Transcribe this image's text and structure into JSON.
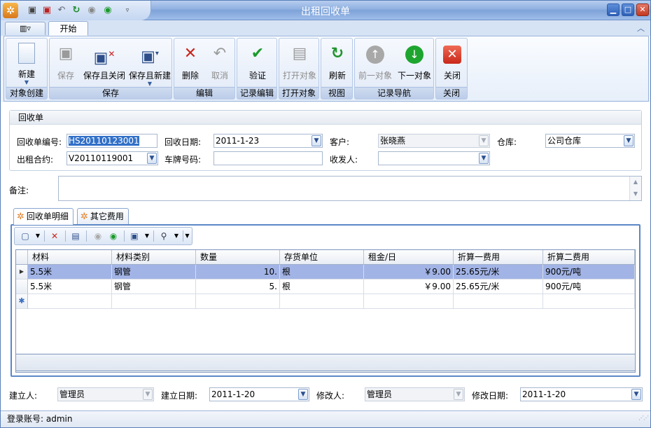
{
  "window": {
    "title": "出租回收单",
    "qat_icons": [
      "save-icon",
      "save-close-icon",
      "undo-icon",
      "refresh-icon",
      "prev-icon",
      "next-icon",
      "customize-dropdown-icon"
    ],
    "controls": [
      "minimize",
      "maximize",
      "close"
    ]
  },
  "tabs": {
    "menu_label": "",
    "home_label": "开始"
  },
  "ribbon": {
    "groups": [
      {
        "label": "对象创建",
        "buttons": [
          {
            "label": "新建",
            "icon": "new-document-icon",
            "enabled": true,
            "dropdown": true
          }
        ]
      },
      {
        "label": "保存",
        "buttons": [
          {
            "label": "保存",
            "icon": "save-icon",
            "enabled": false
          },
          {
            "label": "保存且关闭",
            "icon": "save-close-icon",
            "enabled": true
          },
          {
            "label": "保存且新建",
            "icon": "save-new-icon",
            "enabled": true,
            "dropdown": true
          }
        ]
      },
      {
        "label": "编辑",
        "buttons": [
          {
            "label": "删除",
            "icon": "delete-icon",
            "enabled": true
          },
          {
            "label": "取消",
            "icon": "undo-icon",
            "enabled": false
          }
        ]
      },
      {
        "label": "记录编辑",
        "buttons": [
          {
            "label": "验证",
            "icon": "check-icon",
            "enabled": true
          }
        ]
      },
      {
        "label": "打开对象",
        "buttons": [
          {
            "label": "打开对象",
            "icon": "open-object-icon",
            "enabled": false
          }
        ]
      },
      {
        "label": "视图",
        "buttons": [
          {
            "label": "刷新",
            "icon": "refresh-icon",
            "enabled": true
          }
        ]
      },
      {
        "label": "记录导航",
        "buttons": [
          {
            "label": "前一对象",
            "icon": "previous-icon",
            "enabled": false
          },
          {
            "label": "下一对象",
            "icon": "next-icon",
            "enabled": true
          }
        ]
      },
      {
        "label": "关闭",
        "buttons": [
          {
            "label": "关闭",
            "icon": "close-icon",
            "enabled": true
          }
        ]
      }
    ]
  },
  "form": {
    "section_title": "回收单",
    "receipt_no": {
      "label": "回收单编号:",
      "value": "HS20110123001"
    },
    "receipt_date": {
      "label": "回收日期:",
      "value": "2011-1-23"
    },
    "customer": {
      "label": "客户:",
      "value": "张晓燕"
    },
    "warehouse": {
      "label": "仓库:",
      "value": "公司仓库"
    },
    "contract": {
      "label": "出租合约:",
      "value": "V20110119001"
    },
    "plate_no": {
      "label": "车牌号码:",
      "value": ""
    },
    "receiver": {
      "label": "收发人:",
      "value": ""
    },
    "notes": {
      "label": "备注:",
      "value": ""
    }
  },
  "detail_tabs": [
    {
      "label": "回收单明细",
      "icon": "gear-icon",
      "active": true
    },
    {
      "label": "其它费用",
      "icon": "gear-icon",
      "active": false
    }
  ],
  "grid": {
    "columns": [
      "材料",
      "材料类别",
      "数量",
      "存货单位",
      "租金/日",
      "折算一费用",
      "折算二费用"
    ],
    "rows": [
      {
        "cells": [
          "5.5米",
          "钢管",
          "10.",
          "根",
          "￥9.00",
          "25.65元/米",
          "900元/吨"
        ],
        "selected": true
      },
      {
        "cells": [
          "5.5米",
          "钢管",
          "5.",
          "根",
          "￥9.00",
          "25.65元/米",
          "900元/吨"
        ],
        "selected": false
      }
    ]
  },
  "footer": {
    "created_by": {
      "label": "建立人:",
      "value": "管理员"
    },
    "created_date": {
      "label": "建立日期:",
      "value": "2011-1-20"
    },
    "modified_by": {
      "label": "修改人:",
      "value": "管理员"
    },
    "modified_date": {
      "label": "修改日期:",
      "value": "2011-1-20"
    }
  },
  "status": {
    "text": "登录账号: admin"
  },
  "colors": {
    "selection": "#a2b4e6",
    "accent": "#5b87c6",
    "titlebar": "#8fb0e0"
  }
}
